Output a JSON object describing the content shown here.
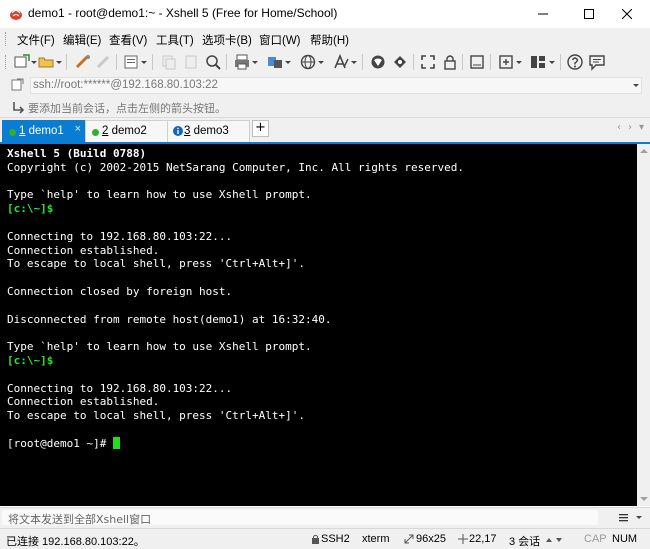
{
  "window": {
    "title": "demo1 - root@demo1:~ - Xshell 5 (Free for Home/School)"
  },
  "menu": {
    "items": [
      "文件(F)",
      "编辑(E)",
      "查看(V)",
      "工具(T)",
      "选项卡(B)",
      "窗口(W)",
      "帮助(H)"
    ]
  },
  "address": {
    "value": "ssh://root:******@192.168.80.103:22"
  },
  "hint": {
    "text": "要添加当前会话，点击左侧的箭头按钮。"
  },
  "tabs": [
    {
      "number": "1",
      "label": "demo1",
      "status": "connected",
      "active": true
    },
    {
      "number": "2",
      "label": "demo2",
      "status": "connected",
      "active": false
    },
    {
      "number": "3",
      "label": "demo3",
      "status": "info",
      "active": false
    }
  ],
  "tab_add_label": "+",
  "terminal": {
    "lines": [
      {
        "text": "Xshell 5 (Build 0788)",
        "style": "bold"
      },
      {
        "text": "Copyright (c) 2002-2015 NetSarang Computer, Inc. All rights reserved.",
        "style": "normal"
      },
      {
        "text": "",
        "style": "normal"
      },
      {
        "text": "Type `help' to learn how to use Xshell prompt.",
        "style": "normal"
      },
      {
        "text": "[c:\\~]$",
        "style": "prompt"
      },
      {
        "text": "",
        "style": "normal"
      },
      {
        "text": "Connecting to 192.168.80.103:22...",
        "style": "normal"
      },
      {
        "text": "Connection established.",
        "style": "normal"
      },
      {
        "text": "To escape to local shell, press 'Ctrl+Alt+]'.",
        "style": "normal"
      },
      {
        "text": "",
        "style": "normal"
      },
      {
        "text": "Connection closed by foreign host.",
        "style": "normal"
      },
      {
        "text": "",
        "style": "normal"
      },
      {
        "text": "Disconnected from remote host(demo1) at 16:32:40.",
        "style": "normal"
      },
      {
        "text": "",
        "style": "normal"
      },
      {
        "text": "Type `help' to learn how to use Xshell prompt.",
        "style": "normal"
      },
      {
        "text": "[c:\\~]$",
        "style": "prompt"
      },
      {
        "text": "",
        "style": "normal"
      },
      {
        "text": "Connecting to 192.168.80.103:22...",
        "style": "normal"
      },
      {
        "text": "Connection established.",
        "style": "normal"
      },
      {
        "text": "To escape to local shell, press 'Ctrl+Alt+]'.",
        "style": "normal"
      },
      {
        "text": "",
        "style": "normal"
      },
      {
        "text": "[root@demo1 ~]# ",
        "style": "cursor"
      }
    ],
    "background": "#000000",
    "foreground": "#ffffff",
    "prompt_color": "#2ee22e"
  },
  "send_bar": {
    "placeholder": "将文本发送到全部Xshell窗口"
  },
  "status": {
    "connection": "已连接 192.168.80.103:22。",
    "protocol": "SSH2",
    "terminal_type": "xterm",
    "size": "96x25",
    "cursor_pos": "22,17",
    "sessions": "3 会话",
    "caps": "CAP",
    "num": "NUM"
  },
  "colors": {
    "accent": "#0a7dd2",
    "connected_dot": "#30b030",
    "info_badge": "#1565c0"
  },
  "icons": [
    "new-session-icon",
    "open-folder-icon",
    "reconnect-icon",
    "disconnect-icon",
    "properties-icon",
    "copy-icon",
    "paste-icon",
    "find-icon",
    "print-icon",
    "transfer-icon",
    "globe-icon",
    "font-icon",
    "xftp-icon",
    "script-icon",
    "fullscreen-icon",
    "lock-icon",
    "compose-icon",
    "new-tab-icon",
    "layout-icon",
    "help-icon",
    "chat-icon"
  ]
}
